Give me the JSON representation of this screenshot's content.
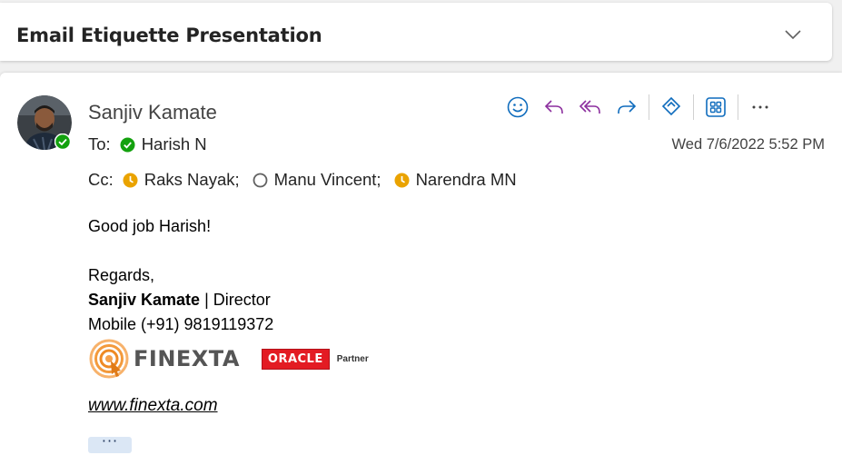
{
  "subject": {
    "title": "Email Etiquette Presentation"
  },
  "message": {
    "sender": "Sanjiv Kamate",
    "to_label": "To:",
    "to": [
      {
        "name": "Harish N",
        "status": "available"
      }
    ],
    "cc_label": "Cc:",
    "cc": [
      {
        "name": "Raks Nayak;",
        "status": "away"
      },
      {
        "name": "Manu Vincent;",
        "status": "offline"
      },
      {
        "name": "Narendra MN",
        "status": "away"
      }
    ],
    "date": "Wed 7/6/2022 5:52 PM",
    "body": {
      "greeting": "Good job Harish!",
      "closing": "Regards,",
      "signature_name": "Sanjiv Kamate",
      "signature_title": " | Director",
      "signature_mobile": "Mobile (+91) 9819119372",
      "finexta_logo_text": "FINEXTA",
      "oracle_logo_text": "ORACLE",
      "oracle_partner_text": "Partner",
      "website": "www.finexta.com",
      "more_label": "···"
    }
  },
  "toolbar": {
    "icons": [
      "emoji-icon",
      "reply-icon",
      "reply-all-icon",
      "forward-icon",
      "loop-icon",
      "apps-icon",
      "more-options-icon"
    ]
  },
  "colors": {
    "available": "#13a10e",
    "away": "#eaa300",
    "accent": "#0f6cbd",
    "reply_purple": "#8c2f9e"
  }
}
